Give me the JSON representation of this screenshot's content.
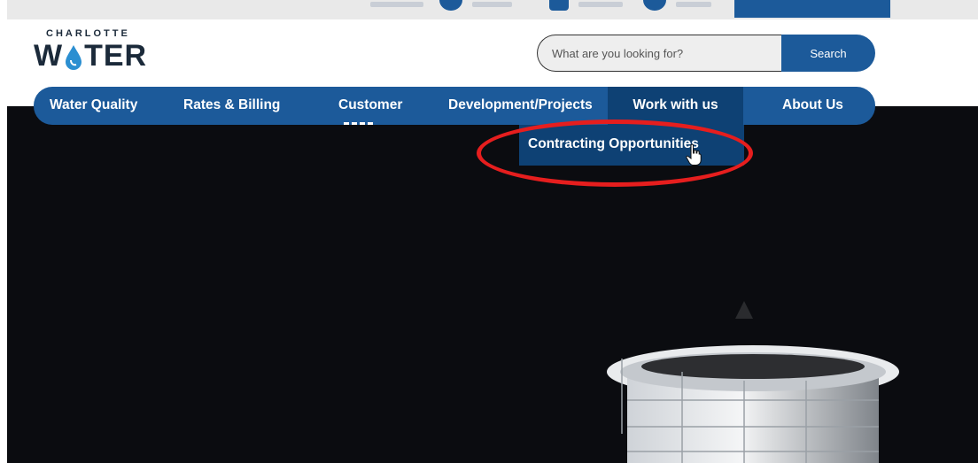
{
  "logo": {
    "top_line": "CHARLOTTE",
    "word_start": "W",
    "word_end": "TER"
  },
  "search": {
    "placeholder": "What are you looking for?",
    "button_label": "Search"
  },
  "nav": {
    "items": [
      {
        "label": "Water Quality"
      },
      {
        "label": "Rates & Billing"
      },
      {
        "label": "Customer"
      },
      {
        "label": "Development/Projects"
      },
      {
        "label": "Work with us",
        "active": true
      },
      {
        "label": "About Us"
      }
    ]
  },
  "dropdown": {
    "items": [
      {
        "label": "Contracting Opportunities"
      }
    ]
  },
  "colors": {
    "brand_blue": "#1c5a9a",
    "brand_blue_dark": "#0e4174",
    "highlight_red": "#e61e1e",
    "hero_bg": "#0b0c10"
  },
  "icons": [
    "water-drop-icon",
    "hand-pointer-cursor-icon"
  ]
}
